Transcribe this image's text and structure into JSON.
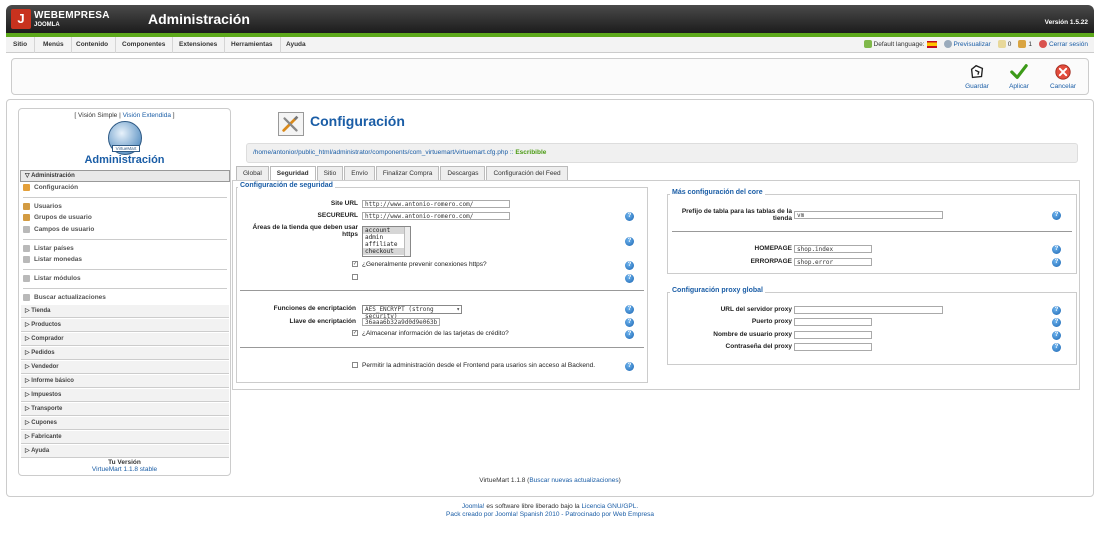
{
  "header": {
    "logo_text": "WEBEMPRESA",
    "logo_sub": "JOOMLA",
    "title": "Administración",
    "version": "Versión 1.5.22"
  },
  "menu": [
    "Sitio",
    "Menús",
    "Contenido",
    "Componentes",
    "Extensiones",
    "Herramientas",
    "Ayuda"
  ],
  "status": {
    "default_language": "Default language:",
    "preview": "Previsualizar",
    "messages_count": "0",
    "users_count": "1",
    "logout": "Cerrar sesión"
  },
  "toolbar": {
    "save": "Guardar",
    "apply": "Aplicar",
    "cancel": "Cancelar"
  },
  "sidebar": {
    "simple_view": "[ Visión Simple",
    "separator": "|",
    "extended_view": "Visión Extendida",
    "close_bracket": "]",
    "logo_label": "VirtueMart",
    "title": "Administración",
    "admin_section": "Administración",
    "links": {
      "configuracion": "Configuración",
      "usuarios": "Usuarios",
      "grupos": "Grupos de usuario",
      "campos": "Campos de usuario",
      "paises": "Listar países",
      "monedas": "Listar monedas",
      "modulos": "Listar módulos",
      "actualizaciones": "Buscar actualizaciones"
    },
    "sections": [
      "Tienda",
      "Productos",
      "Comprador",
      "Pedidos",
      "Vendedor",
      "Informe básico",
      "Impuestos",
      "Transporte",
      "Cupones",
      "Fabricante",
      "Ayuda"
    ],
    "version_label": "Tu Versión",
    "version_value": "VirtueMart 1.1.8 stable"
  },
  "main": {
    "title": "Configuración",
    "path": "/home/antonior/public_html/administrator/components/com_virtuemart/virtuemart.cfg.php",
    "path_sep": "::",
    "path_status": "Escribible",
    "tabs": [
      "Global",
      "Seguridad",
      "Sitio",
      "Envío",
      "Finalizar Compra",
      "Descargas",
      "Configuración del Feed"
    ]
  },
  "security": {
    "legend": "Configuración de seguridad",
    "site_url_label": "Site URL",
    "site_url_value": "http://www.antonio-romero.com/",
    "secure_url_label": "SECUREURL",
    "secure_url_value": "http://www.antonio-romero.com/",
    "https_areas_label": "Áreas de la tienda que deben usar https",
    "https_areas_options": [
      "account",
      "admin",
      "affiliate",
      "checkout"
    ],
    "prevent_https_label": "¿Generalmente prevenir conexiones https?",
    "encryption_functions_label": "Funciones de encriptación",
    "encryption_functions_value": "AES_ENCRYPT (strong security)",
    "encryption_key_label": "Llave de encriptación",
    "encryption_key_value": "36aaa6b32a9d0d9e063bb",
    "store_cards_label": "¿Almacenar información de las tarjetas de crédito?",
    "frontend_admin_label": "Permitir la administración desde el Frontend para usarios sin acceso al Backend."
  },
  "core": {
    "legend": "Más configuración del core",
    "table_prefix_label": "Prefijo de tabla para las tablas de la tienda",
    "table_prefix_value": "vm",
    "homepage_label": "HOMEPAGE",
    "homepage_value": "shop.index",
    "errorpage_label": "ERRORPAGE",
    "errorpage_value": "shop.error"
  },
  "proxy": {
    "legend": "Configuración proxy global",
    "server_label": "URL del servidor proxy",
    "port_label": "Puerto proxy",
    "user_label": "Nombre de usuario proxy",
    "password_label": "Contraseña del proxy"
  },
  "footer": {
    "vm_version": "VirtueMart 1.1.8 (",
    "vm_update_link": "Buscar nuevas actualizaciones",
    "vm_close": ")",
    "joomla_link": "Joomla!",
    "license_text": "es software libre liberado bajo la",
    "license_link": "Licencia GNU/GPL.",
    "pack_text": "Pack creado por Joomla! Spanish 2010 - Patrocinado por Web Empresa"
  },
  "colors": {
    "accent": "#1a5da6",
    "green": "#5ca81a",
    "writable": "#4a9a12"
  }
}
